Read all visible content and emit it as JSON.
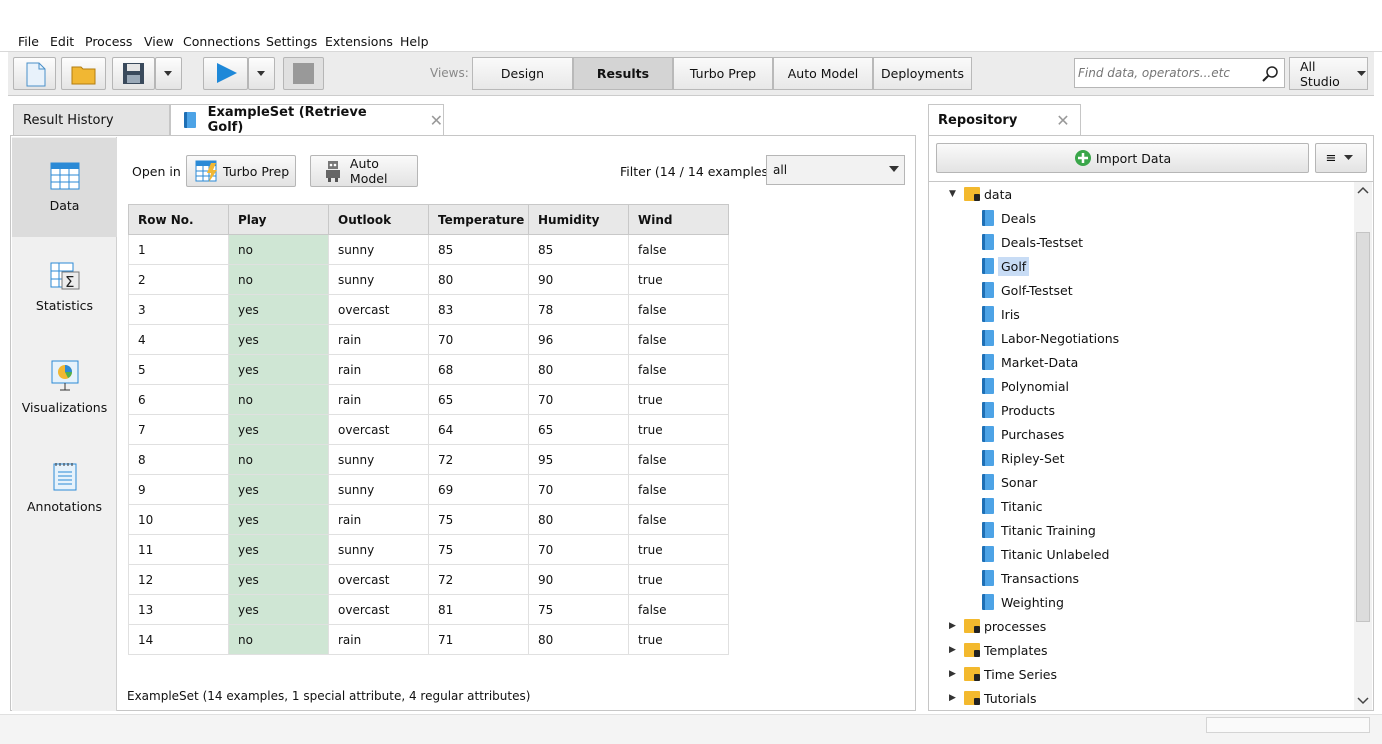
{
  "menu": [
    "File",
    "Edit",
    "Process",
    "View",
    "Connections",
    "Settings",
    "Extensions",
    "Help"
  ],
  "views": {
    "label": "Views:",
    "items": [
      "Design",
      "Results",
      "Turbo Prep",
      "Auto Model",
      "Deployments"
    ],
    "active": "Results"
  },
  "search": {
    "placeholder": "Find data, operators...etc",
    "scope": "All Studio"
  },
  "tabs": {
    "history": "Result History",
    "exampleset": "ExampleSet (Retrieve Golf)"
  },
  "sidenav": [
    "Data",
    "Statistics",
    "Visualizations",
    "Annotations"
  ],
  "open_in": {
    "label": "Open in",
    "turbo_prep": "Turbo Prep",
    "auto_model": "Auto Model"
  },
  "filter": {
    "label": "Filter (14 / 14 examples):",
    "value": "all"
  },
  "table": {
    "columns": [
      "Row No.",
      "Play",
      "Outlook",
      "Temperature",
      "Humidity",
      "Wind"
    ],
    "rows": [
      [
        "1",
        "no",
        "sunny",
        "85",
        "85",
        "false"
      ],
      [
        "2",
        "no",
        "sunny",
        "80",
        "90",
        "true"
      ],
      [
        "3",
        "yes",
        "overcast",
        "83",
        "78",
        "false"
      ],
      [
        "4",
        "yes",
        "rain",
        "70",
        "96",
        "false"
      ],
      [
        "5",
        "yes",
        "rain",
        "68",
        "80",
        "false"
      ],
      [
        "6",
        "no",
        "rain",
        "65",
        "70",
        "true"
      ],
      [
        "7",
        "yes",
        "overcast",
        "64",
        "65",
        "true"
      ],
      [
        "8",
        "no",
        "sunny",
        "72",
        "95",
        "false"
      ],
      [
        "9",
        "yes",
        "sunny",
        "69",
        "70",
        "false"
      ],
      [
        "10",
        "yes",
        "rain",
        "75",
        "80",
        "false"
      ],
      [
        "11",
        "yes",
        "sunny",
        "75",
        "70",
        "true"
      ],
      [
        "12",
        "yes",
        "overcast",
        "72",
        "90",
        "true"
      ],
      [
        "13",
        "yes",
        "overcast",
        "81",
        "75",
        "false"
      ],
      [
        "14",
        "no",
        "rain",
        "71",
        "80",
        "true"
      ]
    ]
  },
  "footer": "ExampleSet (14 examples, 1 special attribute, 4 regular attributes)",
  "repository": {
    "title": "Repository",
    "import_label": "Import Data",
    "root": "data",
    "items": [
      "Deals",
      "Deals-Testset",
      "Golf",
      "Golf-Testset",
      "Iris",
      "Labor-Negotiations",
      "Market-Data",
      "Polynomial",
      "Products",
      "Purchases",
      "Ripley-Set",
      "Sonar",
      "Titanic",
      "Titanic Training",
      "Titanic Unlabeled",
      "Transactions",
      "Weighting"
    ],
    "selected": "Golf",
    "folders": [
      "processes",
      "Templates",
      "Time Series",
      "Tutorials"
    ]
  },
  "colors": {
    "accent": "#1e88d8",
    "play_column": "#cfe6d4",
    "selected": "#c8dcf5"
  }
}
